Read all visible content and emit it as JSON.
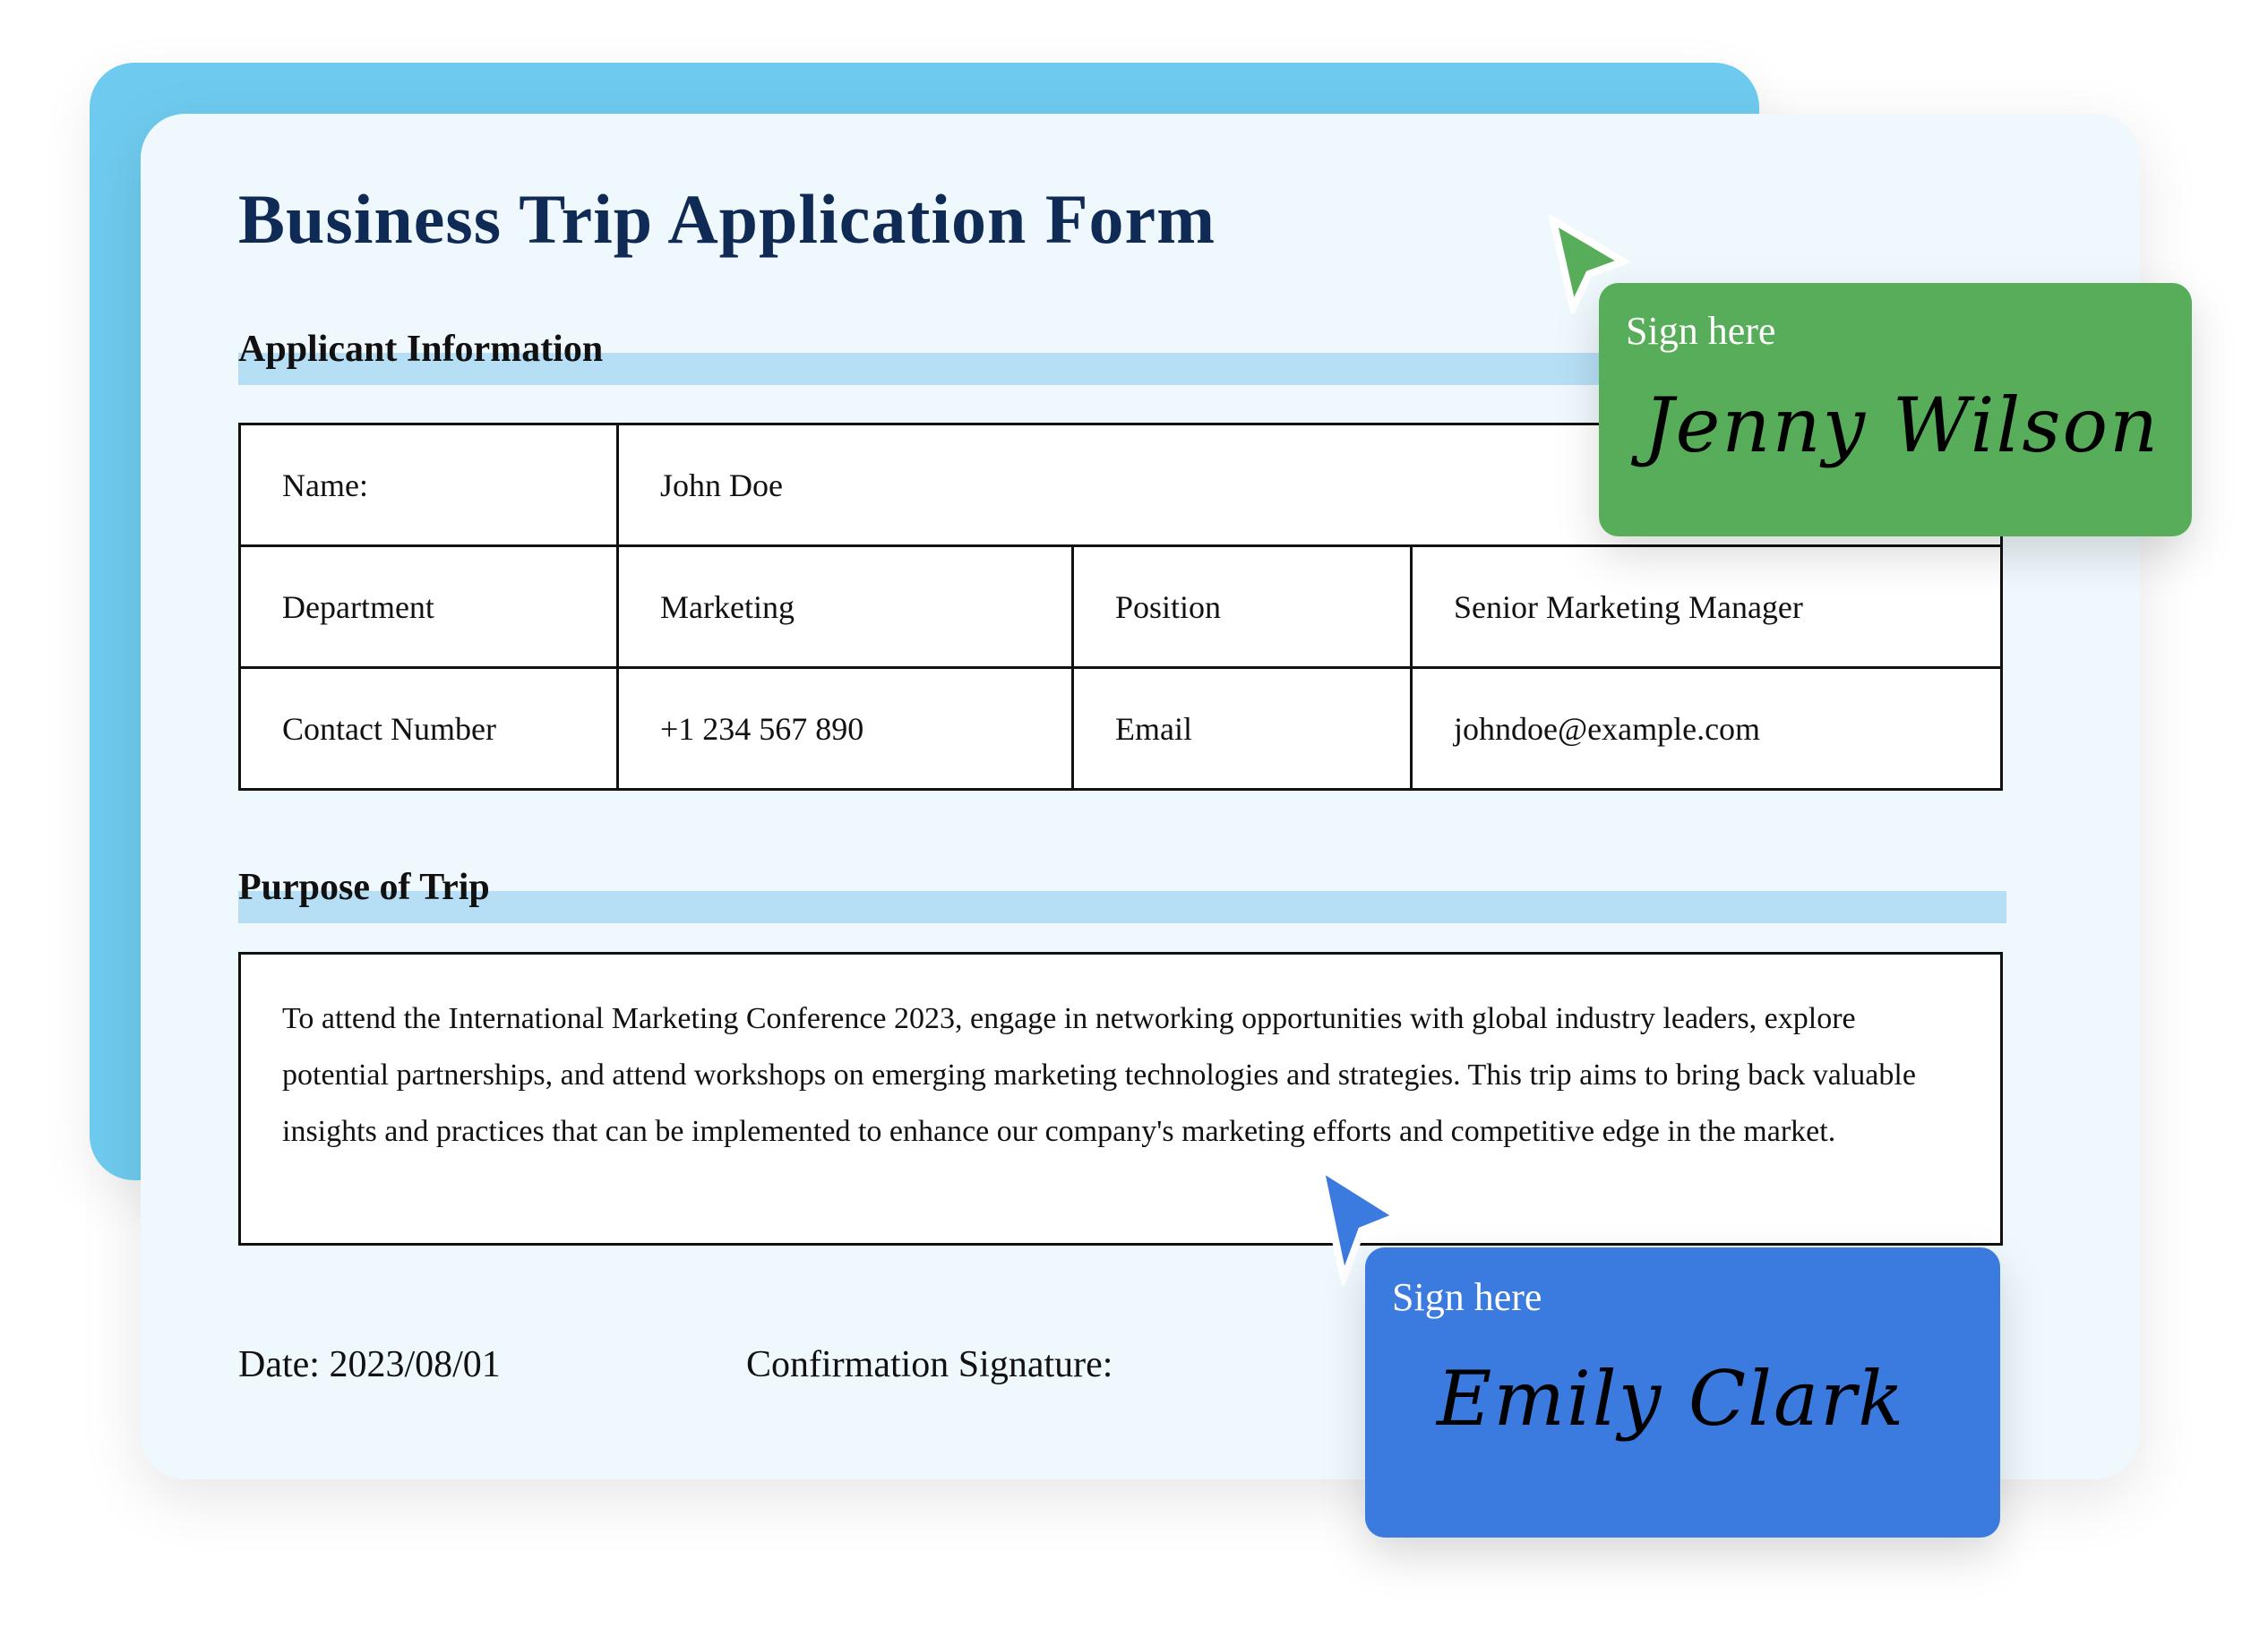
{
  "form": {
    "title": "Business Trip Application Form",
    "applicant_section": "Applicant Information",
    "rows": [
      {
        "label": "Name:",
        "value": "John Doe"
      },
      {
        "label": "Department",
        "value": "Marketing",
        "label2": "Position",
        "value2": "Senior Marketing Manager"
      },
      {
        "label": "Contact Number",
        "value": "+1 234 567 890",
        "label2": "Email",
        "value2": "johndoe@example.com"
      }
    ],
    "purpose_section": "Purpose of Trip",
    "purpose_text": "To attend the International Marketing Conference 2023, engage in networking opportunities with global industry leaders, explore potential partnerships, and attend workshops on emerging marketing technologies and strategies. This trip aims to bring back valuable insights and practices that can be implemented to enhance our company's marketing efforts and competitive edge in the market.",
    "date_label": "Date: 2023/08/01",
    "confirmation_label": "Confirmation Signature:"
  },
  "signatures": [
    {
      "label": "Sign here",
      "signature": "Jenny Wilson",
      "color": "#57ad59",
      "cursor_icon": "arrow-cursor-icon"
    },
    {
      "label": "Sign here",
      "signature": "Emily Clark",
      "color": "#3b7ade",
      "cursor_icon": "arrow-cursor-icon"
    }
  ],
  "colors": {
    "title": "#0f2a55",
    "back_card": "#6ecbef",
    "card": "#eff8fd",
    "section_bar": "#b6dff5"
  }
}
